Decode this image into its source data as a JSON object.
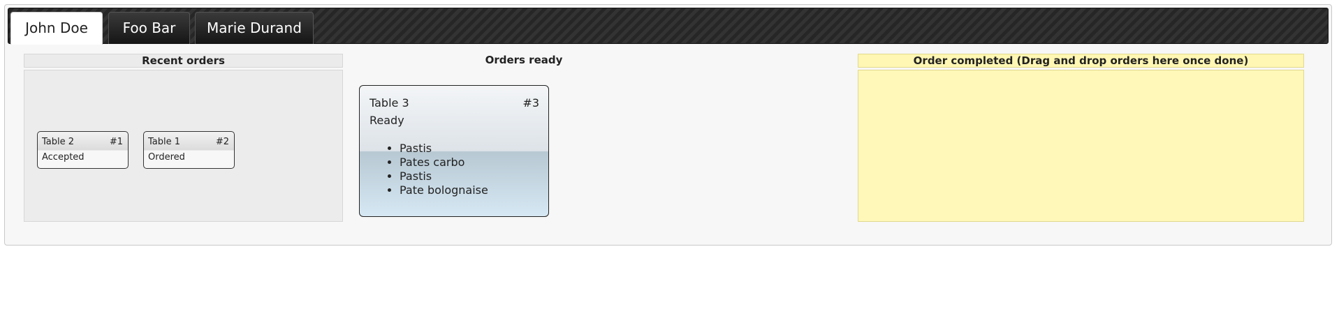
{
  "tabs": [
    {
      "label": "John Doe",
      "active": true
    },
    {
      "label": "Foo Bar",
      "active": false
    },
    {
      "label": "Marie Durand",
      "active": false
    }
  ],
  "columns": {
    "recent": {
      "title": "Recent orders",
      "orders": [
        {
          "table": "Table 2",
          "number": "#1",
          "status": "Accepted"
        },
        {
          "table": "Table 1",
          "number": "#2",
          "status": "Ordered"
        }
      ]
    },
    "ready": {
      "title": "Orders ready",
      "orders": [
        {
          "table": "Table 3",
          "number": "#3",
          "status": "Ready",
          "items": [
            "Pastis",
            "Pates carbo",
            "Pastis",
            "Pate bolognaise"
          ]
        }
      ]
    },
    "done": {
      "title": "Order completed (Drag and drop orders here once done)"
    }
  },
  "colors": {
    "tabbar": "#2b2b2b",
    "done_background": "#fff8b8",
    "recent_background": "#ececec"
  }
}
